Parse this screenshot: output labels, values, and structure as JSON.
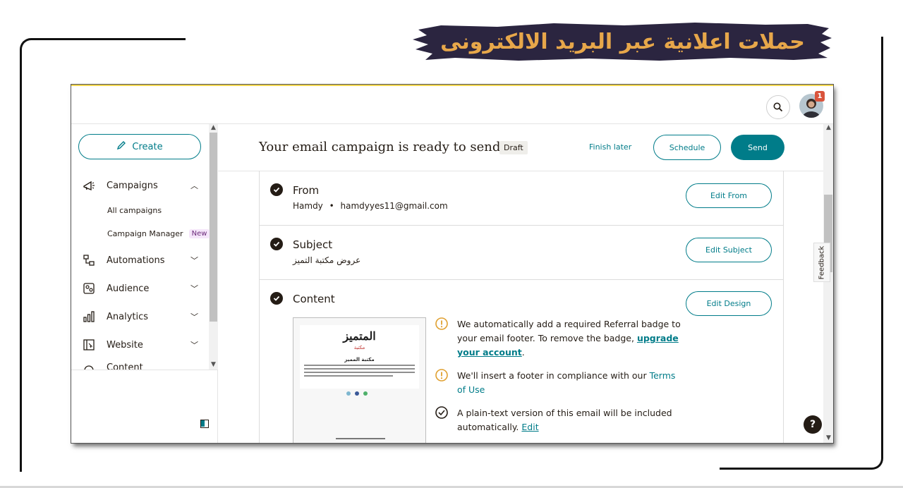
{
  "banner": {
    "title": "حملات اعلانية عبر البريد الالكترونى",
    "bg_color": "#2b2540",
    "text_color": "#e7a74a"
  },
  "topbar": {
    "notification_count": "1"
  },
  "sidebar": {
    "create_label": "Create",
    "items": [
      {
        "label": "Campaigns",
        "icon": "megaphone-icon"
      },
      {
        "label": "Automations",
        "icon": "automation-icon"
      },
      {
        "label": "Audience",
        "icon": "audience-icon"
      },
      {
        "label": "Analytics",
        "icon": "bar-chart-icon"
      },
      {
        "label": "Website",
        "icon": "website-icon"
      },
      {
        "label": "Content",
        "icon": "content-icon"
      }
    ],
    "sub_items": [
      {
        "label": "All campaigns"
      },
      {
        "label": "Campaign Manager",
        "badge": "New"
      }
    ]
  },
  "header": {
    "title": "Your email campaign is ready to send!",
    "status": "Draft",
    "finish_later": "Finish later",
    "schedule": "Schedule",
    "send": "Send"
  },
  "sections": {
    "from": {
      "title": "From",
      "name": "Hamdy",
      "separator": "•",
      "email": "hamdyyes11@gmail.com",
      "button": "Edit From"
    },
    "subject": {
      "title": "Subject",
      "value": "عروض مكتبة التميز",
      "button": "Edit Subject"
    },
    "content": {
      "title": "Content",
      "button": "Edit Design"
    }
  },
  "preview": {
    "logo": "المتميز",
    "logo_sub": "مكتبة",
    "heading": "مكتبة المميز"
  },
  "notes": {
    "n1_text": "We automatically add a required Referral badge to your email footer. To remove the badge,",
    "n1_link": "upgrade your account",
    "n1_end": ".",
    "n2_text": "We'll insert a footer in compliance with our",
    "n2_link": "Terms of Use",
    "n3_text": "A plain-text version of this email will be included automatically.",
    "n3_link": "Edit"
  },
  "feedback_label": "Feedback",
  "help_label": "?",
  "colors": {
    "accent": "#007c89",
    "ink": "#241c15",
    "warning": "#e0a030"
  }
}
